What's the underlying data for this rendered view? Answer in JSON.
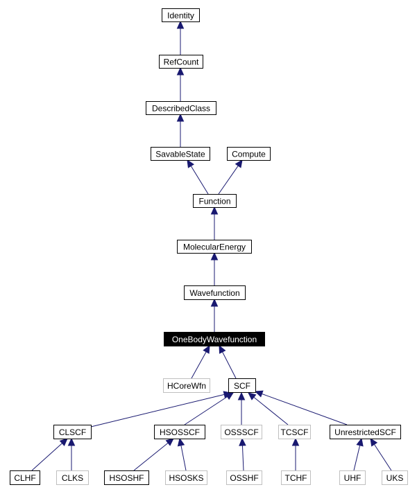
{
  "diagram": {
    "type": "class-inheritance-graph",
    "colors": {
      "edge": "#191970",
      "documented_border": "#000000",
      "undocumented_border": "#bfbfbf",
      "current_fill": "#000000",
      "current_text": "#ffffff",
      "node_fill": "#ffffff",
      "node_text": "#000000"
    },
    "nodes": [
      {
        "id": "Identity",
        "label": "Identity",
        "style": "documented"
      },
      {
        "id": "RefCount",
        "label": "RefCount",
        "style": "documented"
      },
      {
        "id": "DescribedClass",
        "label": "DescribedClass",
        "style": "documented"
      },
      {
        "id": "SavableState",
        "label": "SavableState",
        "style": "documented"
      },
      {
        "id": "Compute",
        "label": "Compute",
        "style": "documented"
      },
      {
        "id": "Function",
        "label": "Function",
        "style": "documented"
      },
      {
        "id": "MolecularEnergy",
        "label": "MolecularEnergy",
        "style": "documented"
      },
      {
        "id": "Wavefunction",
        "label": "Wavefunction",
        "style": "documented"
      },
      {
        "id": "OneBodyWavefunction",
        "label": "OneBodyWavefunction",
        "style": "current"
      },
      {
        "id": "HCoreWfn",
        "label": "HCoreWfn",
        "style": "undocumented"
      },
      {
        "id": "SCF",
        "label": "SCF",
        "style": "documented"
      },
      {
        "id": "CLSCF",
        "label": "CLSCF",
        "style": "documented"
      },
      {
        "id": "HSOSSCF",
        "label": "HSOSSCF",
        "style": "documented"
      },
      {
        "id": "OSSSCF",
        "label": "OSSSCF",
        "style": "undocumented"
      },
      {
        "id": "TCSCF",
        "label": "TCSCF",
        "style": "undocumented"
      },
      {
        "id": "UnrestrictedSCF",
        "label": "UnrestrictedSCF",
        "style": "documented"
      },
      {
        "id": "CLHF",
        "label": "CLHF",
        "style": "documented"
      },
      {
        "id": "CLKS",
        "label": "CLKS",
        "style": "undocumented"
      },
      {
        "id": "HSOSHF",
        "label": "HSOSHF",
        "style": "documented"
      },
      {
        "id": "HSOSKS",
        "label": "HSOSKS",
        "style": "undocumented"
      },
      {
        "id": "OSSHF",
        "label": "OSSHF",
        "style": "undocumented"
      },
      {
        "id": "TCHF",
        "label": "TCHF",
        "style": "undocumented"
      },
      {
        "id": "UHF",
        "label": "UHF",
        "style": "undocumented"
      },
      {
        "id": "UKS",
        "label": "UKS",
        "style": "undocumented"
      }
    ],
    "edges": [
      {
        "from": "RefCount",
        "to": "Identity"
      },
      {
        "from": "DescribedClass",
        "to": "RefCount"
      },
      {
        "from": "SavableState",
        "to": "DescribedClass"
      },
      {
        "from": "Function",
        "to": "SavableState"
      },
      {
        "from": "Function",
        "to": "Compute"
      },
      {
        "from": "MolecularEnergy",
        "to": "Function"
      },
      {
        "from": "Wavefunction",
        "to": "MolecularEnergy"
      },
      {
        "from": "OneBodyWavefunction",
        "to": "Wavefunction"
      },
      {
        "from": "HCoreWfn",
        "to": "OneBodyWavefunction"
      },
      {
        "from": "SCF",
        "to": "OneBodyWavefunction"
      },
      {
        "from": "CLSCF",
        "to": "SCF"
      },
      {
        "from": "HSOSSCF",
        "to": "SCF"
      },
      {
        "from": "OSSSCF",
        "to": "SCF"
      },
      {
        "from": "TCSCF",
        "to": "SCF"
      },
      {
        "from": "UnrestrictedSCF",
        "to": "SCF"
      },
      {
        "from": "CLHF",
        "to": "CLSCF"
      },
      {
        "from": "CLKS",
        "to": "CLSCF"
      },
      {
        "from": "HSOSHF",
        "to": "HSOSSCF"
      },
      {
        "from": "HSOSKS",
        "to": "HSOSSCF"
      },
      {
        "from": "OSSHF",
        "to": "OSSSCF"
      },
      {
        "from": "TCHF",
        "to": "TCSCF"
      },
      {
        "from": "UHF",
        "to": "UnrestrictedSCF"
      },
      {
        "from": "UKS",
        "to": "UnrestrictedSCF"
      }
    ]
  }
}
